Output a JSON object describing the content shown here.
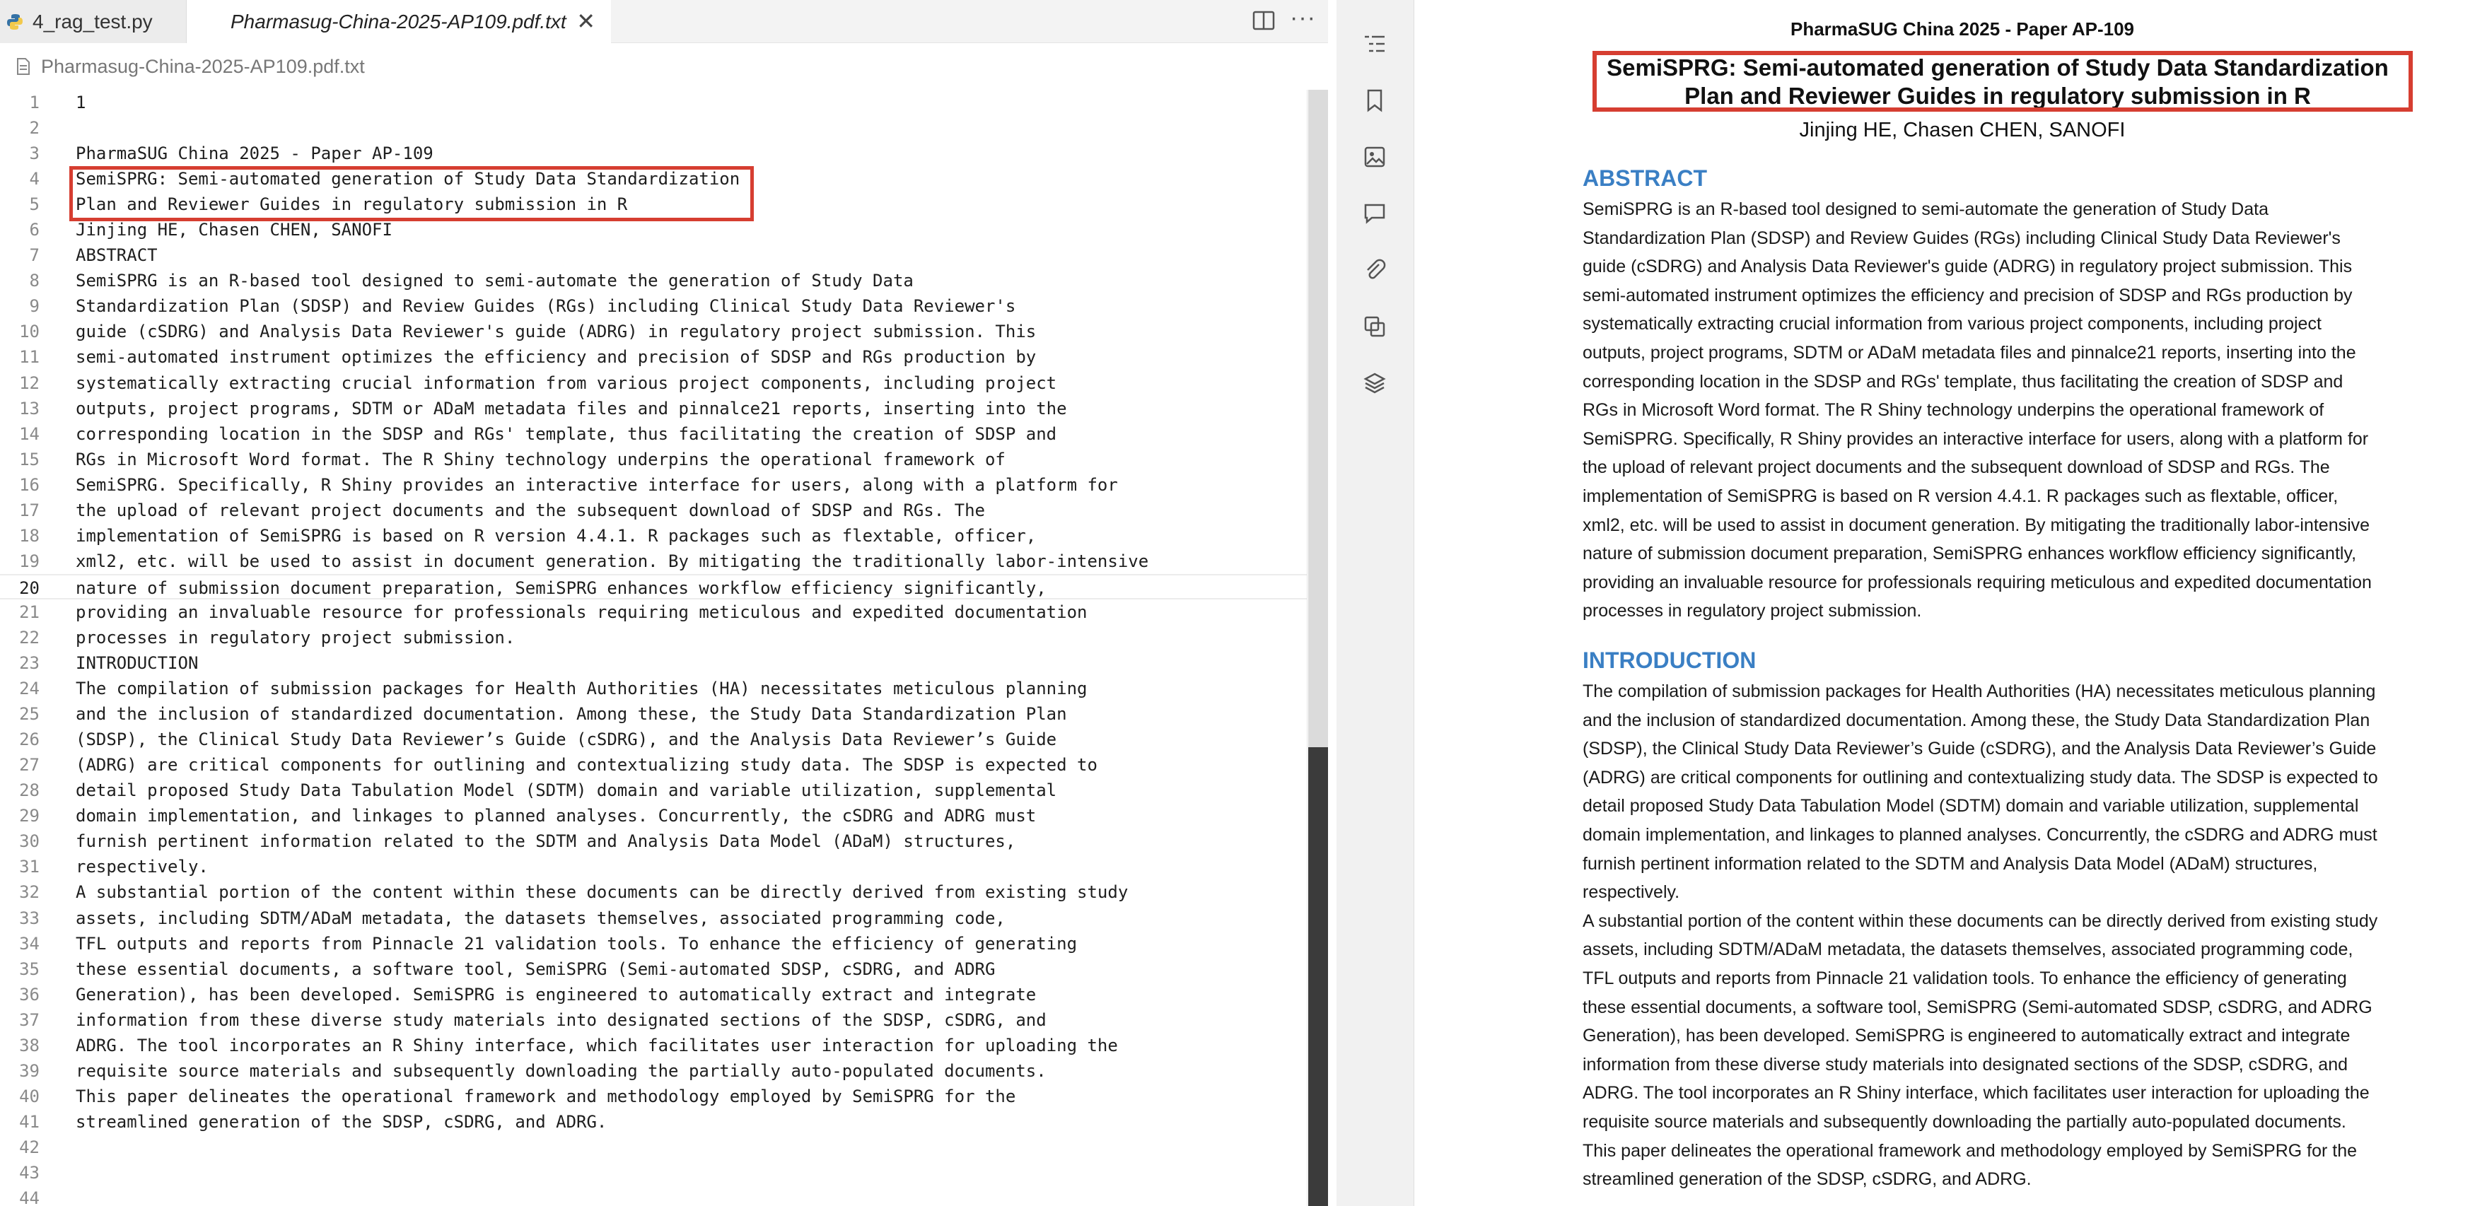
{
  "tabs": [
    {
      "label": "4_rag_test.py"
    },
    {
      "label": "Pharmasug-China-2025-AP109.pdf.txt"
    }
  ],
  "breadcrumb": "Pharmasug-China-2025-AP109.pdf.txt",
  "editor": {
    "current_line": 20,
    "lines": [
      "1",
      "",
      "PharmaSUG China 2025 - Paper AP-109",
      "SemiSPRG: Semi-automated generation of Study Data Standardization",
      "Plan and Reviewer Guides in regulatory submission in R",
      "Jinjing HE, Chasen CHEN, SANOFI",
      "ABSTRACT",
      "SemiSPRG is an R-based tool designed to semi-automate the generation of Study Data",
      "Standardization Plan (SDSP) and Review Guides (RGs) including Clinical Study Data Reviewer's",
      "guide (cSDRG) and Analysis Data Reviewer's guide (ADRG) in regulatory project submission. This",
      "semi-automated instrument optimizes the efficiency and precision of SDSP and RGs production by",
      "systematically extracting crucial information from various project components, including project",
      "outputs, project programs, SDTM or ADaM metadata files and pinnalce21 reports, inserting into the",
      "corresponding location in the SDSP and RGs' template, thus facilitating the creation of SDSP and",
      "RGs in Microsoft Word format. The R Shiny technology underpins the operational framework of",
      "SemiSPRG. Specifically, R Shiny provides an interactive interface for users, along with a platform for",
      "the upload of relevant project documents and the subsequent download of SDSP and RGs. The",
      "implementation of SemiSPRG is based on R version 4.4.1. R packages such as flextable, officer,",
      "xml2, etc. will be used to assist in document generation. By mitigating the traditionally labor-intensive",
      "nature of submission document preparation, SemiSPRG enhances workflow efficiency significantly,",
      "providing an invaluable resource for professionals requiring meticulous and expedited documentation",
      "processes in regulatory project submission.",
      "INTRODUCTION",
      "The compilation of submission packages for Health Authorities (HA) necessitates meticulous planning",
      "and the inclusion of standardized documentation. Among these, the Study Data Standardization Plan",
      "(SDSP), the Clinical Study Data Reviewer’s Guide (cSDRG), and the Analysis Data Reviewer’s Guide",
      "(ADRG) are critical components for outlining and contextualizing study data. The SDSP is expected to",
      "detail proposed Study Data Tabulation Model (SDTM) domain and variable utilization, supplemental",
      "domain implementation, and linkages to planned analyses. Concurrently, the cSDRG and ADRG must",
      "furnish pertinent information related to the SDTM and Analysis Data Model (ADaM) structures,",
      "respectively.",
      "A substantial portion of the content within these documents can be directly derived from existing study",
      "assets, including SDTM/ADaM metadata, the datasets themselves, associated programming code,",
      "TFL outputs and reports from Pinnacle 21 validation tools. To enhance the efficiency of generating",
      "these essential documents, a software tool, SemiSPRG (Semi-automated SDSP, cSDRG, and ADRG",
      "Generation), has been developed. SemiSPRG is engineered to automatically extract and integrate",
      "information from these diverse study materials into designated sections of the SDSP, cSDRG, and",
      "ADRG. The tool incorporates an R Shiny interface, which facilitates user interaction for uploading the",
      "requisite source materials and subsequently downloading the partially auto-populated documents.",
      "This paper delineates the operational framework and methodology employed by SemiSPRG for the",
      "streamlined generation of the SDSP, cSDRG, and ADRG.",
      "",
      "",
      ""
    ]
  },
  "sidebar_icons": [
    "outline-icon",
    "bookmark-icon",
    "image-icon",
    "comment-icon",
    "attachment-icon",
    "layers-copy-icon",
    "layers-icon"
  ],
  "pdf": {
    "header": "PharmaSUG China 2025 - Paper AP-109",
    "title_lines": [
      "SemiSPRG: Semi-automated generation of Study Data Standardization",
      "Plan and Reviewer Guides in regulatory submission in R"
    ],
    "authors": "Jinjing HE, Chasen CHEN, SANOFI",
    "abstract_heading": "ABSTRACT",
    "abstract_lines": [
      "SemiSPRG is an R-based tool designed to semi-automate the generation of Study Data",
      "Standardization Plan (SDSP) and Review Guides (RGs) including Clinical Study Data Reviewer's",
      "guide (cSDRG) and Analysis Data Reviewer's guide (ADRG) in regulatory project submission. This",
      "semi-automated instrument optimizes the efficiency and precision of SDSP and RGs production by",
      "systematically extracting crucial information from various project components, including project",
      "outputs, project programs, SDTM or ADaM metadata files and pinnalce21 reports, inserting into the",
      "corresponding location in the SDSP and RGs' template, thus facilitating the creation of SDSP and",
      "RGs in Microsoft Word format. The R Shiny technology underpins the operational framework of",
      "SemiSPRG. Specifically, R Shiny provides an interactive interface for users, along with a platform for",
      "the upload of relevant project documents and the subsequent download of SDSP and RGs. The",
      "implementation of SemiSPRG is based on R version 4.4.1. R packages such as flextable, officer,",
      "xml2, etc. will be used to assist in document generation. By mitigating the traditionally labor-intensive",
      "nature of submission document preparation, SemiSPRG enhances workflow efficiency significantly,",
      "providing an invaluable resource for professionals requiring meticulous and expedited documentation",
      "processes in regulatory project submission."
    ],
    "intro_heading": "INTRODUCTION",
    "intro_lines": [
      "The compilation of submission packages for Health Authorities (HA) necessitates meticulous planning",
      "and the inclusion of standardized documentation. Among these, the Study Data Standardization Plan",
      "(SDSP), the Clinical Study Data Reviewer’s Guide (cSDRG), and the Analysis Data Reviewer’s Guide",
      "(ADRG) are critical components for outlining and contextualizing study data. The SDSP is expected to",
      "detail proposed Study Data Tabulation Model (SDTM) domain and variable utilization, supplemental",
      "domain implementation, and linkages to planned analyses. Concurrently, the cSDRG and ADRG must",
      "furnish pertinent information related to the SDTM and Analysis Data Model (ADaM) structures,",
      "respectively.",
      "A substantial portion of the content within these documents can be directly derived from existing study",
      "assets, including SDTM/ADaM metadata, the datasets themselves, associated programming code,",
      "TFL outputs and reports from Pinnacle 21 validation tools. To enhance the efficiency of generating",
      "these essential documents, a software tool, SemiSPRG (Semi-automated SDSP, cSDRG, and ADRG",
      "Generation), has been developed. SemiSPRG is engineered to automatically extract and integrate",
      "information from these diverse study materials into designated sections of the SDSP, cSDRG, and",
      "ADRG. The tool incorporates an R Shiny interface, which facilitates user interaction for uploading the",
      "requisite source materials and subsequently downloading the partially auto-populated documents.",
      "This paper delineates the operational framework and methodology employed by SemiSPRG for the",
      "streamlined generation of the SDSP, cSDRG, and ADRG."
    ]
  },
  "colors": {
    "highlight_box": "#d63e31",
    "heading_blue": "#3a7fc4"
  }
}
